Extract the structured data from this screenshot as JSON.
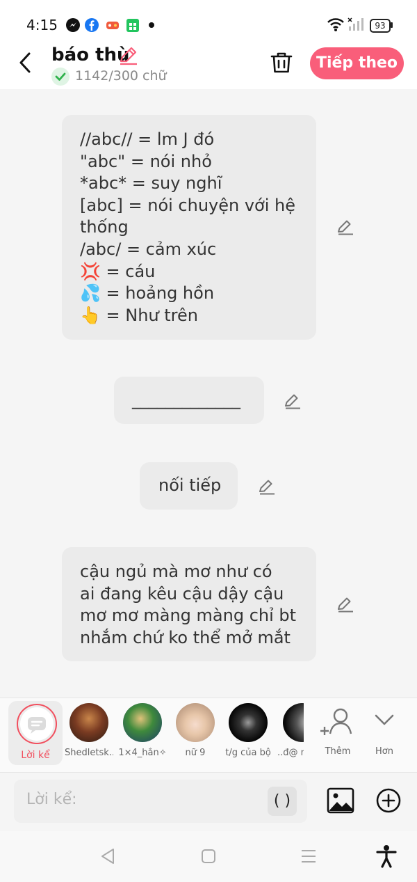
{
  "status_bar": {
    "time": "4:15",
    "battery": "93",
    "icons": [
      "messenger-icon",
      "facebook-icon",
      "game-icon",
      "calendar-icon",
      "wifi-icon",
      "signal-icon"
    ]
  },
  "header": {
    "title": "báo thù",
    "char_count": "1142/300 chữ",
    "next_label": "Tiếp theo"
  },
  "messages": [
    {
      "lines": [
        "//abc// = lm J đó",
        "\"abc\" = nói nhỏ",
        "*abc* = suy nghĩ",
        "[abc] = nói chuyện với hệ",
        "thống",
        "/abc/ = cảm xúc",
        "💢 = cáu",
        "💦 = hoảng hồn",
        "👆 = Như trên"
      ]
    },
    {
      "lines": [
        "_____________"
      ]
    },
    {
      "lines": [
        "nối tiếp"
      ]
    },
    {
      "lines": [
        "cậu ngủ mà mơ như có",
        "ai đang kêu cậu dậy cậu",
        "mơ mơ màng màng chỉ bt",
        "nhắm chứ ko thể mở mắt"
      ]
    }
  ],
  "characters": {
    "narrator_label": "Lời kể",
    "items": [
      "Shedletsk...",
      "1×4_hắn✧",
      "nữ 9",
      "t/g của bộ",
      "..đ@ nh"
    ],
    "more_label": "Thêm",
    "expand_label": "Hơn"
  },
  "input": {
    "placeholder": "Lời kể:",
    "paren_label": "( )"
  },
  "colors": {
    "accent": "#f95e7a",
    "narrator": "#f14f5e",
    "bubble": "#ebebeb",
    "background": "#f5f5f5"
  }
}
